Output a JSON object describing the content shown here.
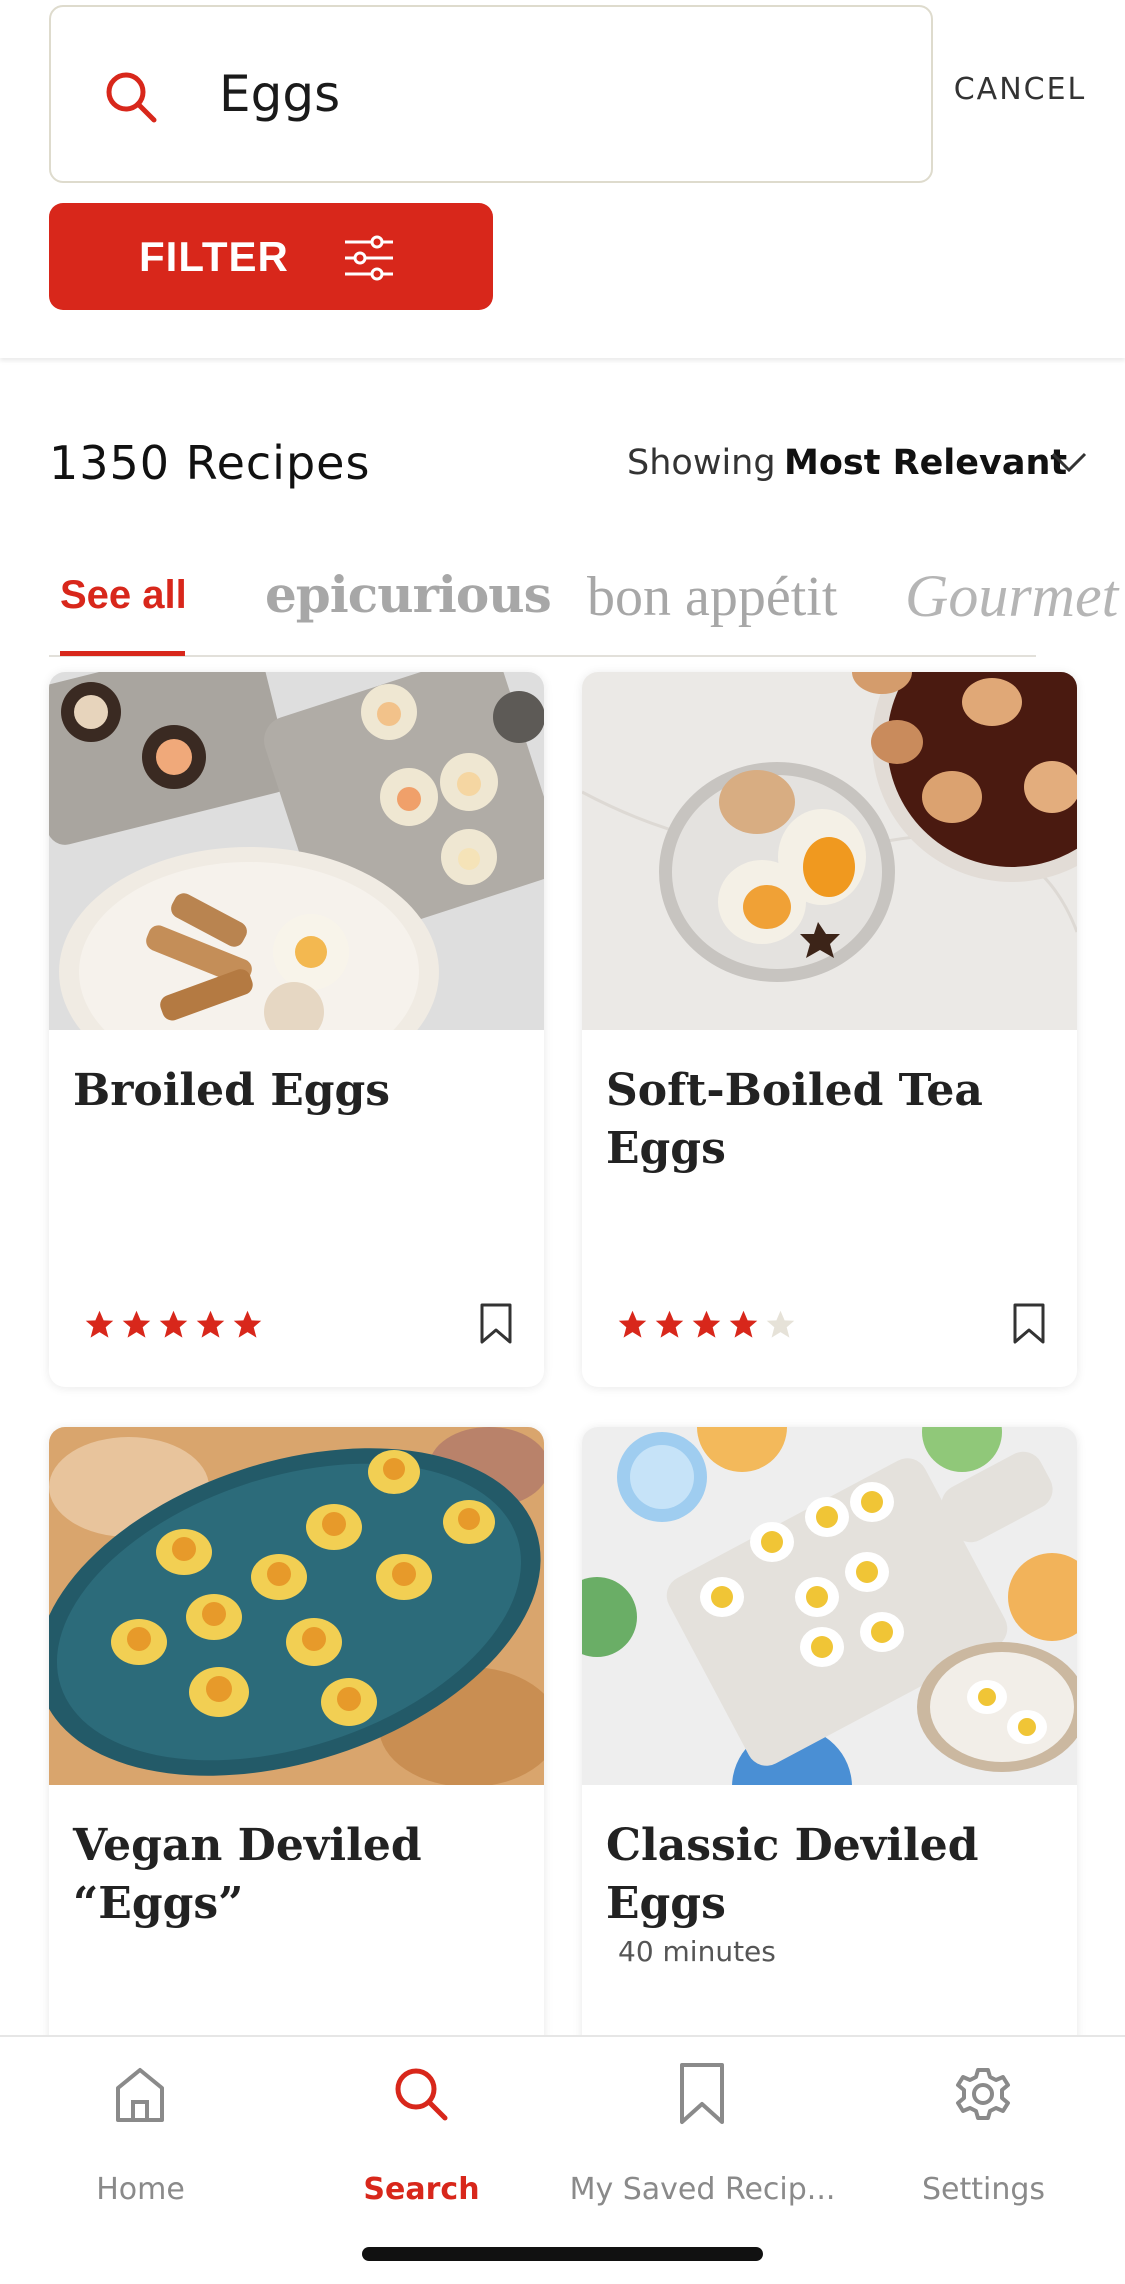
{
  "search": {
    "query": "Eggs",
    "cancel_label": "CANCEL",
    "filter_label": "FILTER"
  },
  "results": {
    "count_label": "1350 Recipes",
    "showing_label": "Showing",
    "sort_value": "Most Relevant"
  },
  "brand_tabs": [
    {
      "label": "See all",
      "selected": true
    },
    {
      "label": "epicurious",
      "selected": false
    },
    {
      "label": "bon appétit",
      "selected": false
    },
    {
      "label": "Gourmet",
      "selected": false
    }
  ],
  "recipes": [
    {
      "title": "Broiled Eggs",
      "meta": "",
      "rating": 5,
      "max_rating": 5
    },
    {
      "title": "Soft-Boiled Tea Eggs",
      "meta": "",
      "rating": 4,
      "max_rating": 5
    },
    {
      "title": "Vegan Deviled “Eggs”",
      "meta": "",
      "rating": null,
      "max_rating": 5
    },
    {
      "title": "Classic Deviled Eggs",
      "meta": "40 minutes",
      "rating": null,
      "max_rating": 5
    }
  ],
  "nav": [
    {
      "label": "Home",
      "icon": "home-icon",
      "active": false
    },
    {
      "label": "Search",
      "icon": "search-icon",
      "active": true
    },
    {
      "label": "My Saved Recip...",
      "icon": "bookmark-icon",
      "active": false
    },
    {
      "label": "Settings",
      "icon": "gear-icon",
      "active": false
    }
  ],
  "colors": {
    "accent": "#d8271b",
    "star_filled": "#d8271b",
    "star_empty": "#e6e2d8",
    "muted_text": "#8a8a8a"
  }
}
